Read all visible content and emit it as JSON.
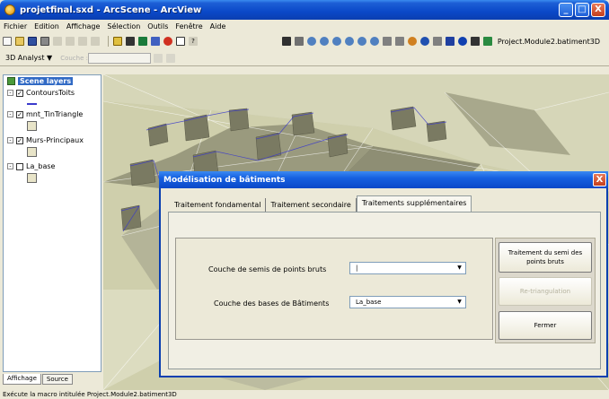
{
  "window": {
    "title": "projetfinal.sxd - ArcScene - ArcView",
    "minimize": "_",
    "maximize": "□",
    "close": "X"
  },
  "menu": [
    "Fichier",
    "Edition",
    "Affichage",
    "Sélection",
    "Outils",
    "Fenêtre",
    "Aide"
  ],
  "toolbar": {
    "macro_label": "Project.Module2.batiment3D",
    "analyst_label": "3D Analyst ▼",
    "layer_label": "Couche :"
  },
  "toc": {
    "root": "Scene layers",
    "layers": [
      {
        "name": "ContoursToits",
        "checked": true
      },
      {
        "name": "mnt_TinTriangle",
        "checked": true
      },
      {
        "name": "Murs-Principaux",
        "checked": true
      },
      {
        "name": "La_base",
        "checked": false
      }
    ],
    "tab_display": "Affichage",
    "tab_source": "Source"
  },
  "status": "Exécute la macro intitulée Project.Module2.batiment3D",
  "dialog": {
    "title": "Modélisation de bâtiments",
    "close": "X",
    "tabs": [
      "Traitement fondamental",
      "Traitement secondaire",
      "Traitements supplémentaires"
    ],
    "active_tab": 2,
    "fields": [
      {
        "label": "Couche de semis de points bruts",
        "value": "|"
      },
      {
        "label": "Couche des bases de Bâtiments",
        "value": "La_base"
      }
    ],
    "combo_arrow": "▼",
    "buttons": {
      "process": "Traitement du semi des points bruts",
      "retriangulate": "Re-triangulation",
      "close": "Fermer"
    }
  },
  "colors": {
    "titlebar": "#0a48c8",
    "panel": "#ece9d8",
    "selection": "#316ac5",
    "terrain": "#d8d8b4",
    "tin_edge": "#3a3acc"
  }
}
